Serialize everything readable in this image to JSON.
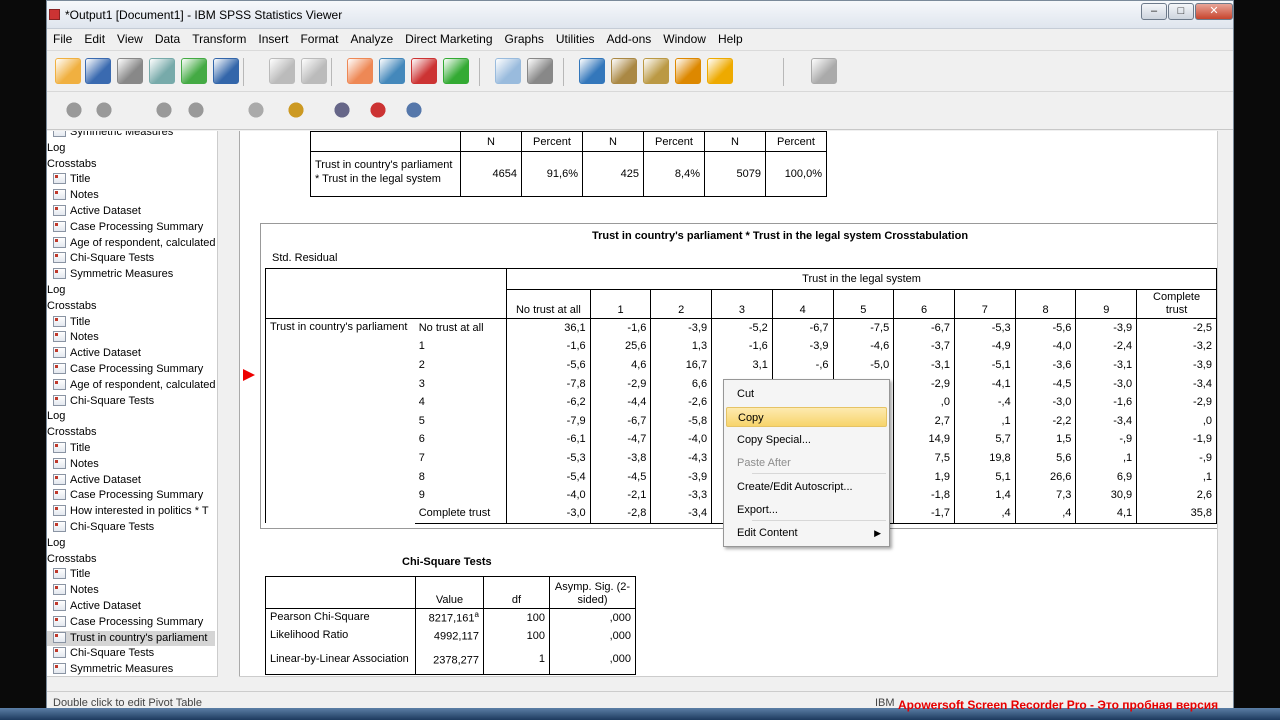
{
  "window": {
    "title": "*Output1 [Document1] - IBM SPSS Statistics Viewer"
  },
  "menu": [
    "File",
    "Edit",
    "View",
    "Data",
    "Transform",
    "Insert",
    "Format",
    "Analyze",
    "Direct Marketing",
    "Graphs",
    "Utilities",
    "Add-ons",
    "Window",
    "Help"
  ],
  "nav": [
    {
      "t": "Symmetric Measures",
      "icon": true
    },
    {
      "t": "Log",
      "icon": false
    },
    {
      "t": "Crosstabs",
      "icon": false
    },
    {
      "t": "Title",
      "icon": true
    },
    {
      "t": "Notes",
      "icon": true
    },
    {
      "t": "Active Dataset",
      "icon": true
    },
    {
      "t": "Case Processing Summary",
      "icon": true
    },
    {
      "t": "Age of respondent, calculated",
      "icon": true
    },
    {
      "t": "Chi-Square Tests",
      "icon": true
    },
    {
      "t": "Symmetric Measures",
      "icon": true
    },
    {
      "t": "Log",
      "icon": false
    },
    {
      "t": "Crosstabs",
      "icon": false
    },
    {
      "t": "Title",
      "icon": true
    },
    {
      "t": "Notes",
      "icon": true
    },
    {
      "t": "Active Dataset",
      "icon": true
    },
    {
      "t": "Case Processing Summary",
      "icon": true
    },
    {
      "t": "Age of respondent, calculated",
      "icon": true
    },
    {
      "t": "Chi-Square Tests",
      "icon": true
    },
    {
      "t": "Log",
      "icon": false
    },
    {
      "t": "Crosstabs",
      "icon": false
    },
    {
      "t": "Title",
      "icon": true
    },
    {
      "t": "Notes",
      "icon": true
    },
    {
      "t": "Active Dataset",
      "icon": true
    },
    {
      "t": "Case Processing Summary",
      "icon": true
    },
    {
      "t": "How interested in politics * T",
      "icon": true
    },
    {
      "t": "Chi-Square Tests",
      "icon": true
    },
    {
      "t": "Log",
      "icon": false
    },
    {
      "t": "Crosstabs",
      "icon": false
    },
    {
      "t": "Title",
      "icon": true
    },
    {
      "t": "Notes",
      "icon": true
    },
    {
      "t": "Active Dataset",
      "icon": true
    },
    {
      "t": "Case Processing Summary",
      "icon": true
    },
    {
      "t": "Trust in country's parliament",
      "icon": true,
      "sel": true
    },
    {
      "t": "Chi-Square Tests",
      "icon": true
    },
    {
      "t": "Symmetric Measures",
      "icon": true
    }
  ],
  "case_summary": {
    "headers": [
      "N",
      "Percent",
      "N",
      "Percent",
      "N",
      "Percent"
    ],
    "row_label": "Trust in country's parliament * Trust in the legal system",
    "values": [
      "4654",
      "91,6%",
      "425",
      "8,4%",
      "5079",
      "100,0%"
    ]
  },
  "crosstab": {
    "title": "Trust in country's parliament * Trust in the legal system Crosstabulation",
    "subtitle": "Std. Residual",
    "col_group": "Trust in the legal system",
    "col_headers": [
      "No trust at all",
      "1",
      "2",
      "3",
      "4",
      "5",
      "6",
      "7",
      "8",
      "9",
      "Complete trust"
    ],
    "row_var": "Trust in country's parliament",
    "rows": [
      {
        "label": "No trust at all",
        "vals": [
          "36,1",
          "-1,6",
          "-3,9",
          "-5,2",
          "-6,7",
          "-7,5",
          "-6,7",
          "-5,3",
          "-5,6",
          "-3,9",
          "-2,5"
        ]
      },
      {
        "label": "1",
        "vals": [
          "-1,6",
          "25,6",
          "1,3",
          "-1,6",
          "-3,9",
          "-4,6",
          "-3,7",
          "-4,9",
          "-4,0",
          "-2,4",
          "-3,2"
        ]
      },
      {
        "label": "2",
        "vals": [
          "-5,6",
          "4,6",
          "16,7",
          "3,1",
          "-,6",
          "-5,0",
          "-3,1",
          "-5,1",
          "-3,6",
          "-3,1",
          "-3,9"
        ]
      },
      {
        "label": "3",
        "vals": [
          "-7,8",
          "-2,9",
          "6,6",
          "",
          "",
          "",
          "-2,9",
          "-4,1",
          "-4,5",
          "-3,0",
          "-3,4"
        ]
      },
      {
        "label": "4",
        "vals": [
          "-6,2",
          "-4,4",
          "-2,6",
          "",
          "",
          "",
          ",0",
          "-,4",
          "-3,0",
          "-1,6",
          "-2,9"
        ]
      },
      {
        "label": "5",
        "vals": [
          "-7,9",
          "-6,7",
          "-5,8",
          "",
          "",
          "",
          "2,7",
          ",1",
          "-2,2",
          "-3,4",
          ",0"
        ]
      },
      {
        "label": "6",
        "vals": [
          "-6,1",
          "-4,7",
          "-4,0",
          "",
          "",
          "",
          "14,9",
          "5,7",
          "1,5",
          "-,9",
          "-1,9"
        ]
      },
      {
        "label": "7",
        "vals": [
          "-5,3",
          "-3,8",
          "-4,3",
          "",
          "",
          "",
          "7,5",
          "19,8",
          "5,6",
          ",1",
          "-,9"
        ]
      },
      {
        "label": "8",
        "vals": [
          "-5,4",
          "-4,5",
          "-3,9",
          "",
          "",
          "",
          "1,9",
          "5,1",
          "26,6",
          "6,9",
          ",1"
        ]
      },
      {
        "label": "9",
        "vals": [
          "-4,0",
          "-2,1",
          "-3,3",
          "",
          "",
          "",
          "-1,8",
          "1,4",
          "7,3",
          "30,9",
          "2,6"
        ]
      },
      {
        "label": "Complete trust",
        "vals": [
          "-3,0",
          "-2,8",
          "-3,4",
          "",
          "",
          "",
          "-1,7",
          ",4",
          ",4",
          "4,1",
          "35,8"
        ]
      }
    ]
  },
  "chisq": {
    "title": "Chi-Square Tests",
    "headers": [
      "Value",
      "df",
      "Asymp. Sig. (2-sided)"
    ],
    "rows": [
      {
        "label": "Pearson Chi-Square",
        "value": "8217,161",
        "sup": "a",
        "df": "100",
        "sig": ",000"
      },
      {
        "label": "Likelihood Ratio",
        "value": "4992,117",
        "sup": "",
        "df": "100",
        "sig": ",000"
      },
      {
        "label": "Linear-by-Linear Association",
        "value": "2378,277",
        "sup": "",
        "df": "1",
        "sig": ",000"
      }
    ]
  },
  "context_menu": [
    {
      "label": "Cut",
      "state": "normal"
    },
    {
      "label": "Copy",
      "state": "highlight"
    },
    {
      "label": "Copy Special...",
      "state": "normal"
    },
    {
      "label": "Paste After",
      "state": "disabled"
    },
    {
      "label": "Create/Edit Autoscript...",
      "state": "normal"
    },
    {
      "label": "Export...",
      "state": "normal"
    },
    {
      "label": "Edit Content",
      "state": "normal",
      "submenu": true
    }
  ],
  "status": {
    "left": "Double click to edit Pivot Table",
    "right": "IBM"
  },
  "watermark": "Apowersoft Screen Recorder Pro - Это пробная версия"
}
